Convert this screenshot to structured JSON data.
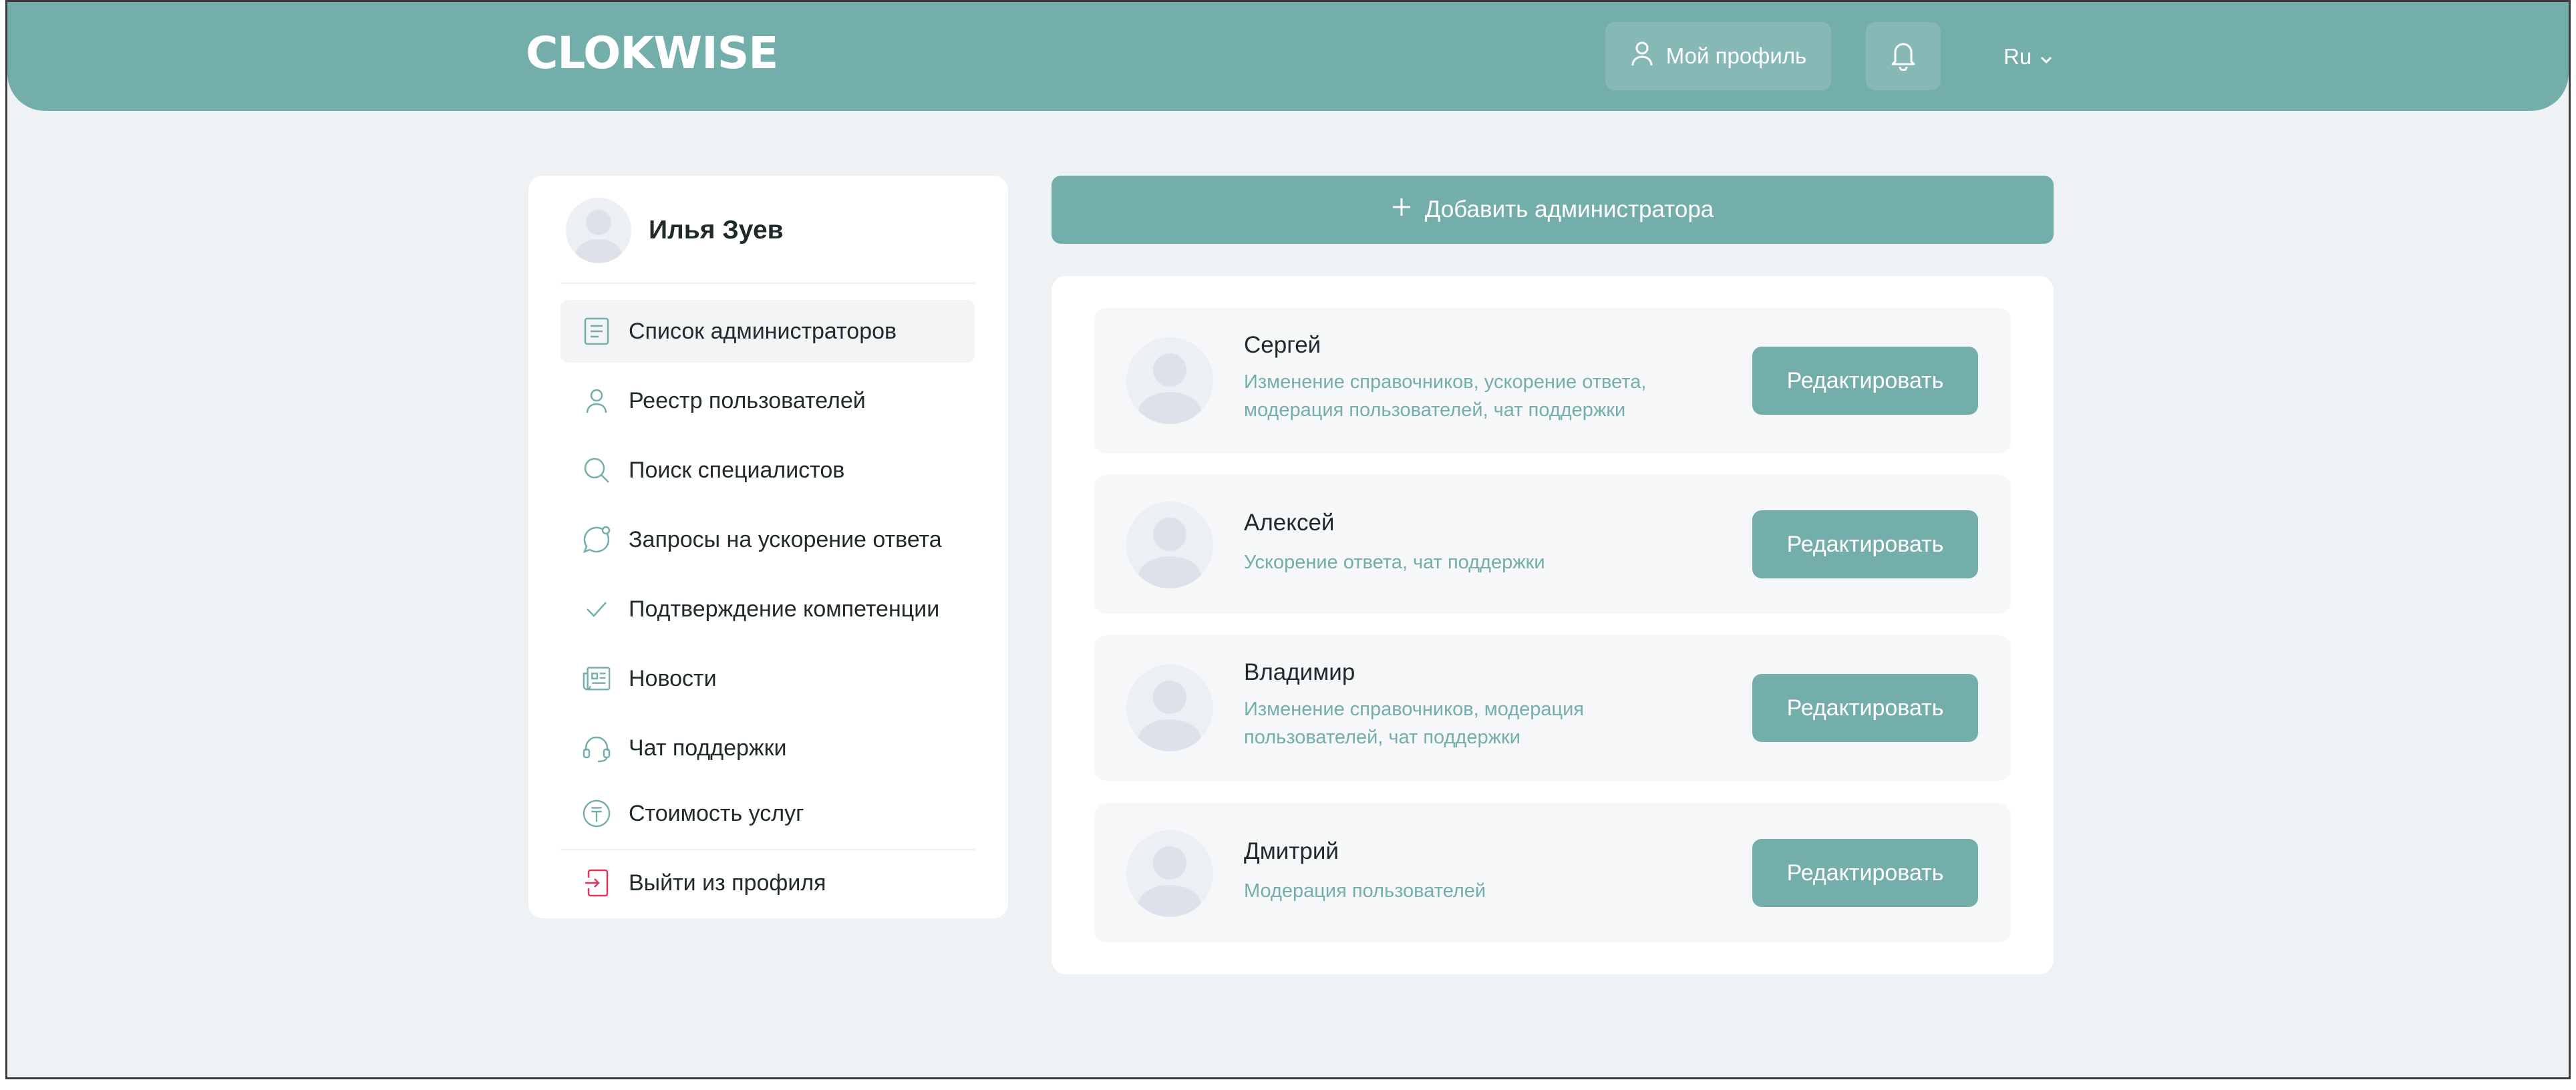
{
  "header": {
    "logo": "CLOKWISE",
    "profile_label": "Мой профиль",
    "lang_label": "Ru"
  },
  "sidebar": {
    "user_name": "Илья Зуев",
    "items": [
      {
        "label": "Список администраторов",
        "icon": "list-icon"
      },
      {
        "label": "Реестр пользователей",
        "icon": "user-icon"
      },
      {
        "label": "Поиск специалистов",
        "icon": "search-icon"
      },
      {
        "label": "Запросы на ускорение ответа",
        "icon": "chat-bubble-icon"
      },
      {
        "label": "Подтверждение компетенции",
        "icon": "check-icon"
      },
      {
        "label": "Новости",
        "icon": "news-icon"
      },
      {
        "label": "Чат поддержки",
        "icon": "headset-icon"
      },
      {
        "label": "Стоимость услуг",
        "icon": "tenge-icon"
      }
    ],
    "logout_label": "Выйти из профиля"
  },
  "main": {
    "add_admin_label": "Добавить администратора",
    "admins": [
      {
        "name": "Сергей",
        "permissions": "Изменение справочников, ускорение ответа, модерация пользователей, чат поддержки",
        "edit_label": "Редактировать"
      },
      {
        "name": "Алексей",
        "permissions": "Ускорение ответа, чат поддержки",
        "edit_label": "Редактировать"
      },
      {
        "name": "Владимир",
        "permissions": "Изменение справочников, модерация пользователей, чат поддержки",
        "edit_label": "Редактировать"
      },
      {
        "name": "Дмитрий",
        "permissions": "Модерация пользователей",
        "edit_label": "Редактировать"
      }
    ]
  },
  "colors": {
    "accent": "#74aeaa",
    "background": "#eef2f4",
    "logout_icon": "#e0385c"
  }
}
